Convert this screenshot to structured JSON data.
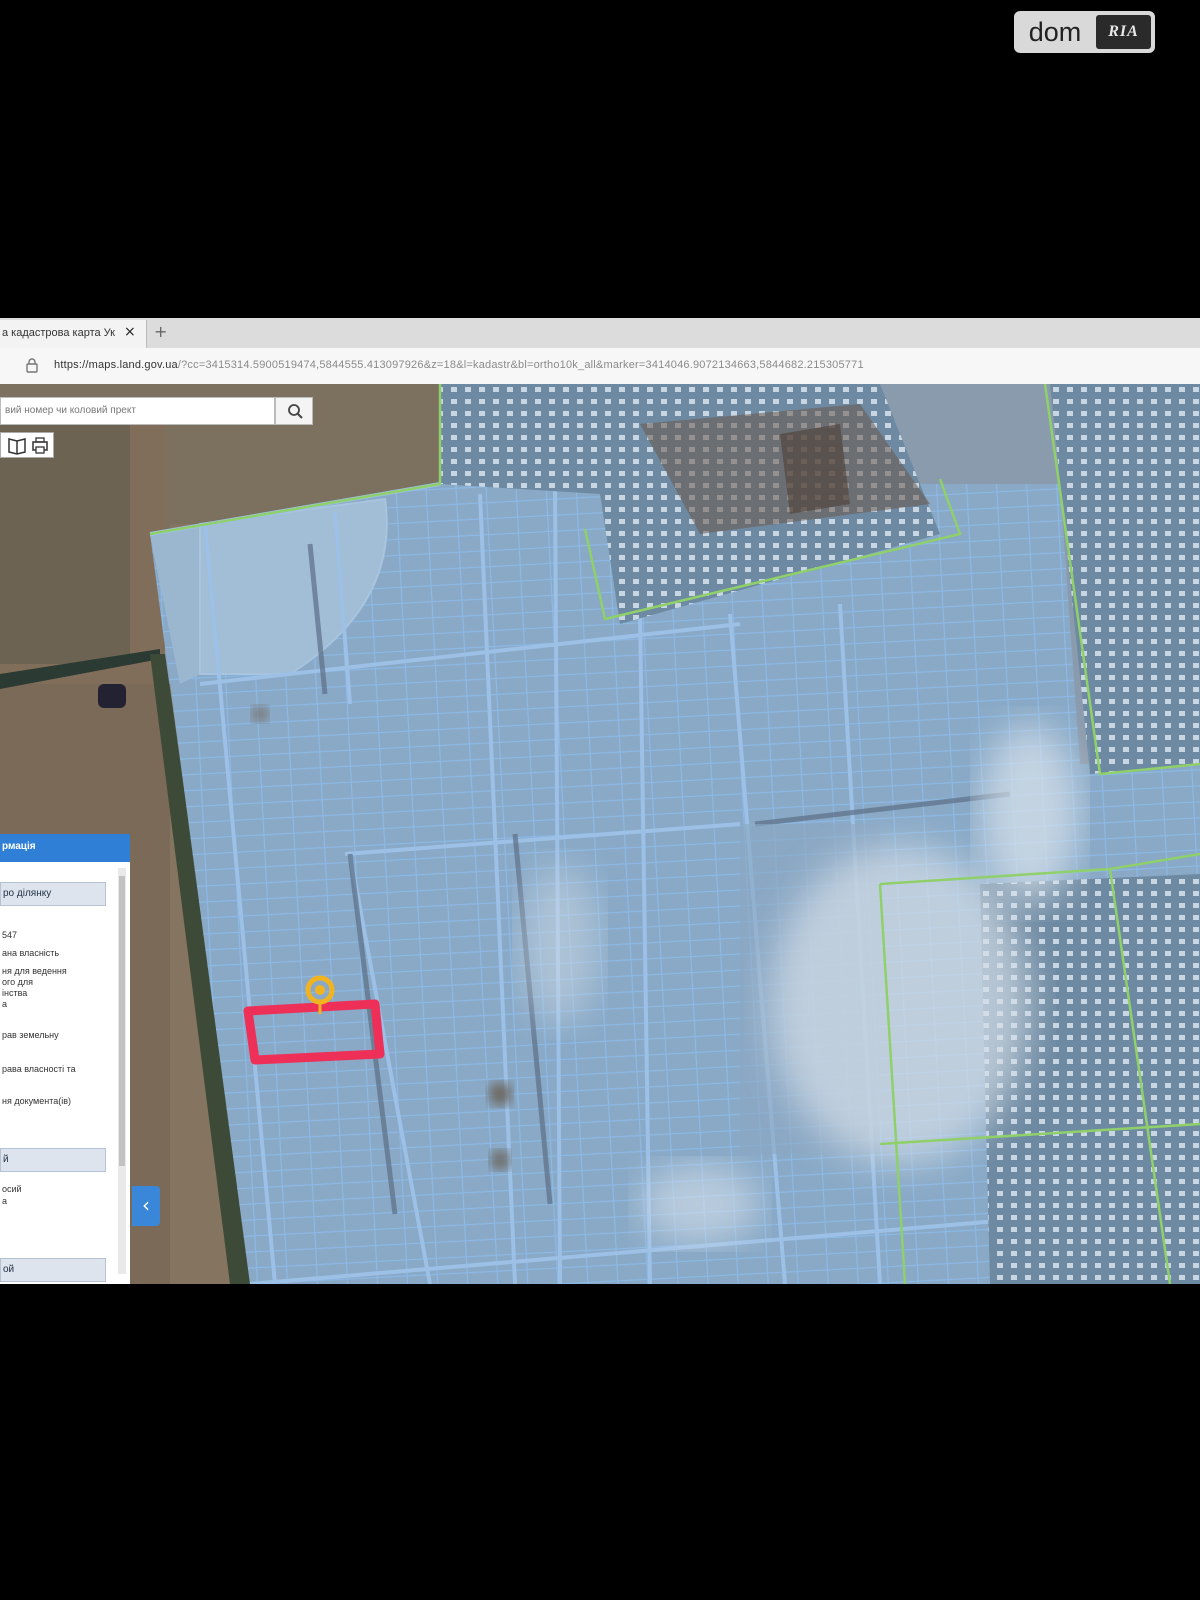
{
  "watermark": {
    "dom": "dom",
    "ria": "RIA"
  },
  "browser": {
    "tab_title": "а кадастрова карта Ук",
    "tab_close": "×",
    "new_tab": "+",
    "url_host": "https://maps.land.gov.ua",
    "url_rest": "/?cc=3415314.5900519474,5844555.413097926&z=18&l=kadastr&bl=ortho10k_all&marker=3414046.9072134663,5844682.215305771"
  },
  "search": {
    "placeholder": "вий номер чи коловий прект"
  },
  "panel": {
    "title": "рмація",
    "button_1": "ро ділянку",
    "lines": [
      "547",
      "ана власність",
      "ня для ведення",
      "ого для",
      "інства",
      "а",
      "рав земельну",
      "рава власності та",
      "ня документа(ів)"
    ],
    "button_2": "й",
    "lines_2": [
      "осий",
      "а"
    ],
    "button_3": "ой"
  },
  "colors": {
    "parcel_border": "#8cb9e6",
    "zone_border": "#8fd06a",
    "selected_parcel": "#ee2f57",
    "marker": "#f2b320",
    "panel_header": "#2f7fd6"
  }
}
